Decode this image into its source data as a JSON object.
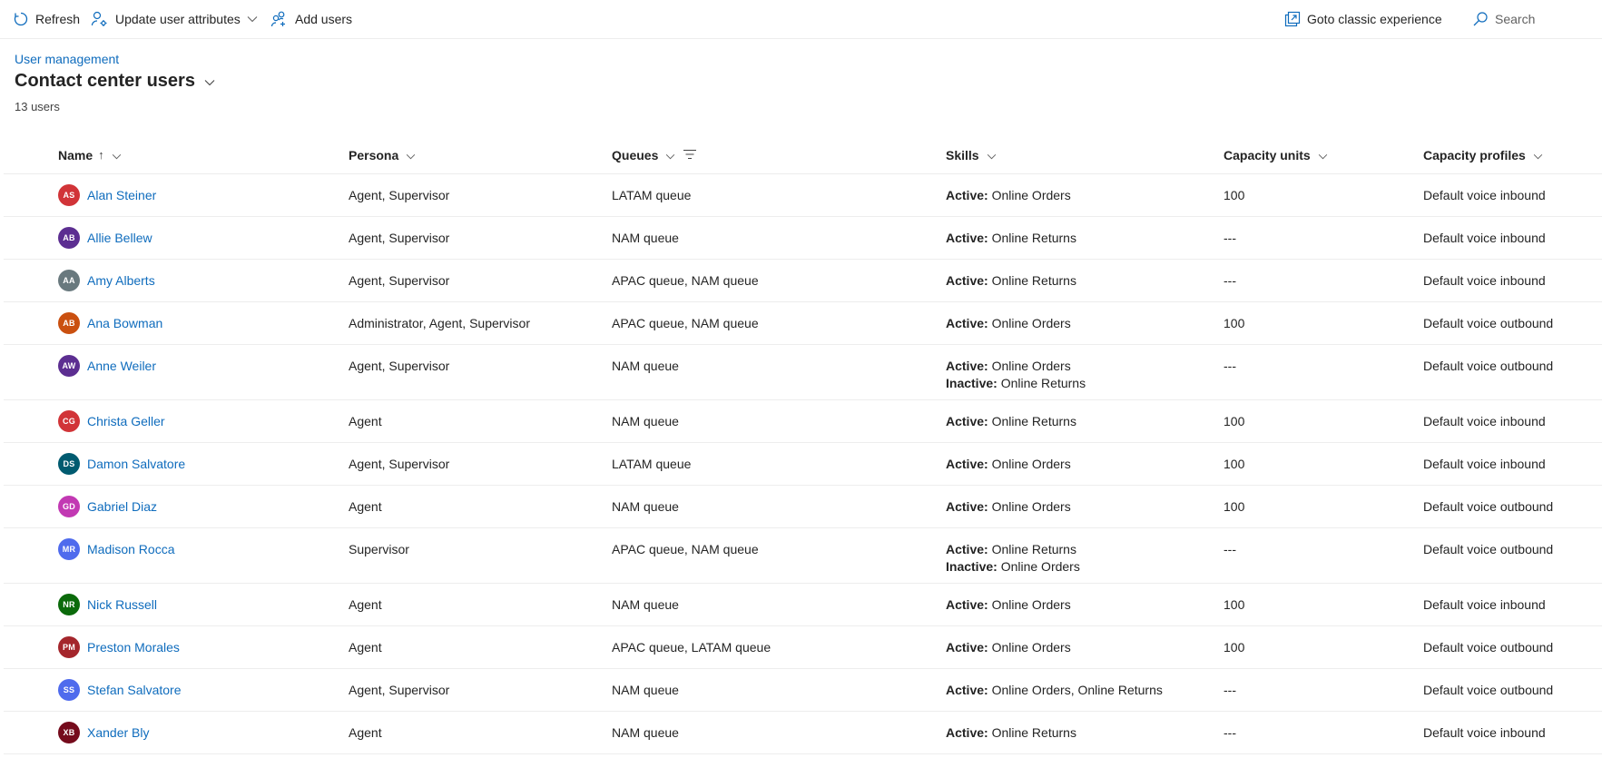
{
  "toolbar": {
    "refresh": "Refresh",
    "update_attributes": "Update user attributes",
    "add_users": "Add users",
    "classic": "Goto classic experience",
    "search": "Search"
  },
  "header": {
    "breadcrumb": "User management",
    "title": "Contact center users",
    "count": "13 users"
  },
  "columns": {
    "name": "Name",
    "name_sort": "↑",
    "persona": "Persona",
    "queues": "Queues",
    "skills": "Skills",
    "capacity_units": "Capacity units",
    "capacity_profiles": "Capacity profiles"
  },
  "labels": {
    "active": "Active:",
    "inactive": "Inactive:"
  },
  "rows": [
    {
      "initials": "AS",
      "color": "#d13438",
      "name": "Alan Steiner",
      "persona": "Agent, Supervisor",
      "queues": "LATAM queue",
      "active": "Online Orders",
      "inactive": null,
      "capacity": "100",
      "profile": "Default voice inbound"
    },
    {
      "initials": "AB",
      "color": "#5c2e91",
      "name": "Allie Bellew",
      "persona": "Agent, Supervisor",
      "queues": "NAM queue",
      "active": "Online Returns",
      "inactive": null,
      "capacity": "---",
      "profile": "Default voice inbound"
    },
    {
      "initials": "AA",
      "color": "#69797e",
      "name": "Amy Alberts",
      "persona": "Agent, Supervisor",
      "queues": "APAC queue, NAM queue",
      "active": "Online Returns",
      "inactive": null,
      "capacity": "---",
      "profile": "Default voice inbound"
    },
    {
      "initials": "AB",
      "color": "#ca5010",
      "name": "Ana Bowman",
      "persona": "Administrator, Agent, Supervisor",
      "queues": "APAC queue, NAM queue",
      "active": "Online Orders",
      "inactive": null,
      "capacity": "100",
      "profile": "Default voice outbound"
    },
    {
      "initials": "AW",
      "color": "#5c2e91",
      "name": "Anne Weiler",
      "persona": "Agent, Supervisor",
      "queues": "NAM queue",
      "active": "Online Orders",
      "inactive": "Online Returns",
      "capacity": "---",
      "profile": "Default voice outbound"
    },
    {
      "initials": "CG",
      "color": "#d13438",
      "name": "Christa Geller",
      "persona": "Agent",
      "queues": "NAM queue",
      "active": "Online Returns",
      "inactive": null,
      "capacity": "100",
      "profile": "Default voice inbound"
    },
    {
      "initials": "DS",
      "color": "#005b70",
      "name": "Damon Salvatore",
      "persona": "Agent, Supervisor",
      "queues": "LATAM queue",
      "active": "Online Orders",
      "inactive": null,
      "capacity": "100",
      "profile": "Default voice inbound"
    },
    {
      "initials": "GD",
      "color": "#c239b3",
      "name": "Gabriel Diaz",
      "persona": "Agent",
      "queues": "NAM queue",
      "active": "Online Orders",
      "inactive": null,
      "capacity": "100",
      "profile": "Default voice outbound"
    },
    {
      "initials": "MR",
      "color": "#4f6bed",
      "name": "Madison Rocca",
      "persona": "Supervisor",
      "queues": "APAC queue, NAM queue",
      "active": "Online Returns",
      "inactive": "Online Orders",
      "capacity": "---",
      "profile": "Default voice outbound"
    },
    {
      "initials": "NR",
      "color": "#0b6a0b",
      "name": "Nick Russell",
      "persona": "Agent",
      "queues": "NAM queue",
      "active": "Online Orders",
      "inactive": null,
      "capacity": "100",
      "profile": "Default voice inbound"
    },
    {
      "initials": "PM",
      "color": "#a4262c",
      "name": "Preston Morales",
      "persona": "Agent",
      "queues": "APAC queue, LATAM queue",
      "active": "Online Orders",
      "inactive": null,
      "capacity": "100",
      "profile": "Default voice outbound"
    },
    {
      "initials": "SS",
      "color": "#4f6bed",
      "name": "Stefan Salvatore",
      "persona": "Agent, Supervisor",
      "queues": "NAM queue",
      "active": "Online Orders, Online Returns",
      "inactive": null,
      "capacity": "---",
      "profile": "Default voice outbound"
    },
    {
      "initials": "XB",
      "color": "#750b1c",
      "name": "Xander Bly",
      "persona": "Agent",
      "queues": "NAM queue",
      "active": "Online Returns",
      "inactive": null,
      "capacity": "---",
      "profile": "Default voice inbound"
    }
  ]
}
